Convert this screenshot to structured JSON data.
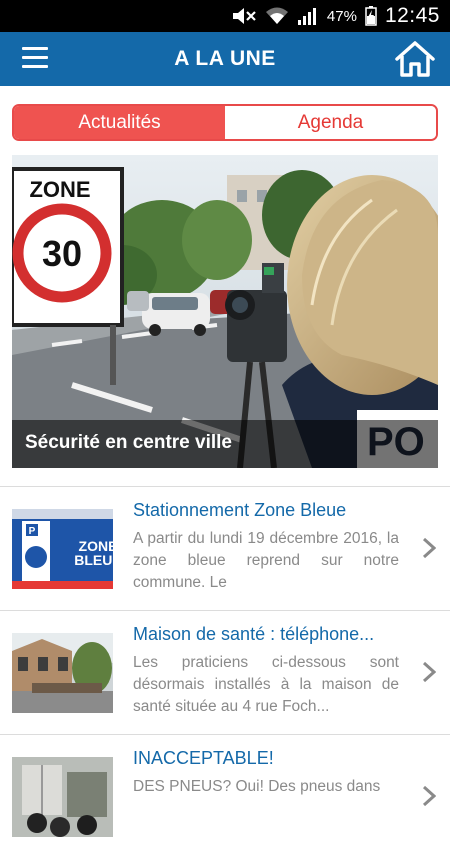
{
  "status_bar": {
    "battery_percent": "47%",
    "time": "12:45",
    "icons": [
      "mute-icon",
      "wifi-icon",
      "signal-icon",
      "battery-icon"
    ]
  },
  "app_bar": {
    "title": "A LA UNE",
    "left_icon": "menu-icon",
    "right_icon": "home-icon"
  },
  "tabs": {
    "actualites": "Actualités",
    "agenda": "Agenda",
    "active": "actualites"
  },
  "featured": {
    "caption": "Sécurité en centre ville",
    "sign_zone": "ZONE",
    "sign_speed": "30"
  },
  "news": [
    {
      "title": "Stationnement Zone Bleue",
      "excerpt": "A partir du lundi 19 décembre 2016, la zone bleue reprend sur notre commune. Le",
      "thumb_letters": [
        "P",
        "ZONE",
        "BLEUE"
      ]
    },
    {
      "title": "Maison de santé : téléphone...",
      "excerpt": "Les praticiens ci-dessous sont désormais installés à la maison de santé située au 4 rue Foch..."
    },
    {
      "title": "INACCEPTABLE!",
      "excerpt": "DES PNEUS? Oui! Des pneus dans"
    }
  ],
  "colors": {
    "app_bar": "#1469a9",
    "accent_red": "#ef5350",
    "link_blue": "#1469a9",
    "text_gray": "#8a8a8a"
  }
}
